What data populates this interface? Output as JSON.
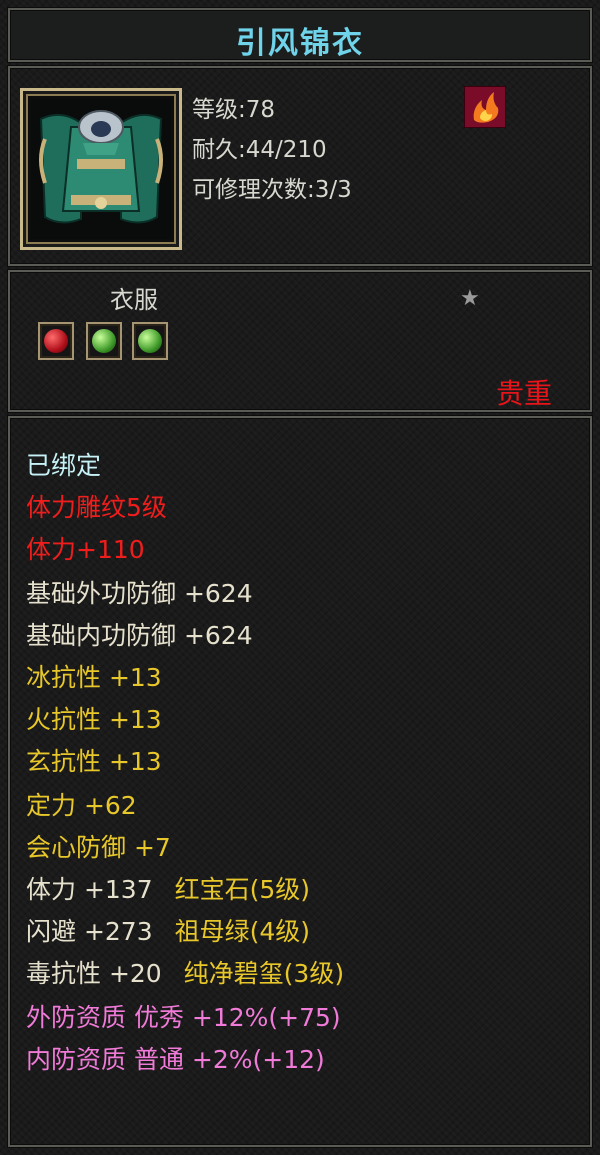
{
  "item": {
    "name": "引风锦衣",
    "stats": {
      "level": "等级:78",
      "durability": "耐久:44/210",
      "repairs": "可修理次数:3/3"
    },
    "category": "衣服",
    "rarity": "贵重",
    "sockets": [
      {
        "gem": "red",
        "icon": "red-gem-icon"
      },
      {
        "gem": "green",
        "icon": "green-gem-icon"
      },
      {
        "gem": "green",
        "icon": "green-gem-icon"
      }
    ],
    "colors": {
      "title": "#6fd3ea",
      "bound": "#c6f1f6",
      "red": "#f01d1d",
      "white": "#e6e1cd",
      "yellow": "#e8c72a",
      "pink": "#f07ad8"
    }
  },
  "attributes": {
    "bound": "已绑定",
    "engrave": "体力雕纹5级",
    "engrave_bonus": "体力+110",
    "base_outer_def": "基础外功防御 +624",
    "base_inner_def": "基础内功防御 +624",
    "ice_res": "冰抗性 +13",
    "fire_res": "火抗性 +13",
    "myst_res": "玄抗性 +13",
    "focus": "定力 +62",
    "crit_def": "会心防御 +7",
    "gem1_stat": "体力 +137",
    "gem1_name": "红宝石(5级)",
    "gem2_stat": "闪避 +273",
    "gem2_name": "祖母绿(4级)",
    "gem3_stat": "毒抗性 +20",
    "gem3_name": "纯净碧玺(3级)",
    "apt_outer": "外防资质  优秀 +12%(+75)",
    "apt_inner": "内防资质  普通 +2%(+12)"
  }
}
